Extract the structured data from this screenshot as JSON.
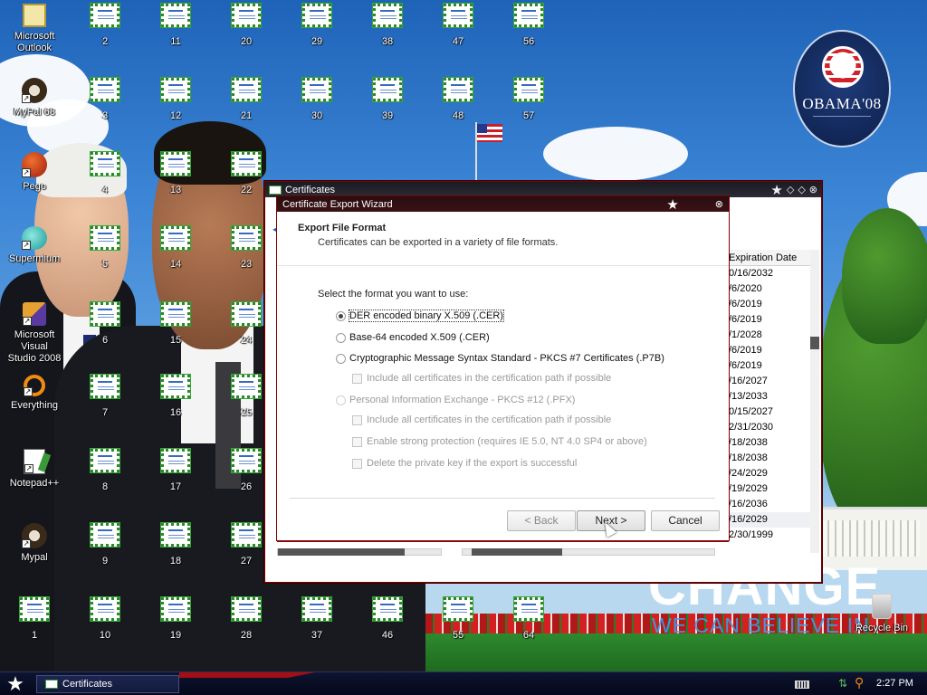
{
  "desktop": {
    "app_icons": [
      {
        "label": "Microsoft\nOutlook",
        "icon": "outlook-icon"
      },
      {
        "label": "MyPal 68",
        "icon": "mypal-icon"
      },
      {
        "label": "Pego",
        "icon": "pego-icon"
      },
      {
        "label": "Supermium",
        "icon": "supermium-icon"
      },
      {
        "label": "Microsoft Visual\nStudio 2008",
        "icon": "visual-studio-icon"
      },
      {
        "label": "Everything",
        "icon": "everything-icon"
      },
      {
        "label": "Notepad++",
        "icon": "notepad-plus-plus-icon"
      },
      {
        "label": "Mypal",
        "icon": "mypal-icon"
      },
      {
        "label": "1",
        "icon": "certificate-icon"
      }
    ],
    "cert_icons": [
      [
        "2",
        "3",
        "4",
        "5",
        "6",
        "7",
        "8",
        "9",
        "10"
      ],
      [
        "11",
        "12",
        "13",
        "14",
        "15",
        "16",
        "17",
        "18",
        "19"
      ],
      [
        "20",
        "21",
        "22",
        "23",
        "24",
        "25",
        "26",
        "27",
        "28"
      ],
      [
        "29",
        "30",
        "",
        "",
        "",
        "",
        "",
        "",
        "37"
      ],
      [
        "38",
        "39",
        "",
        "",
        "",
        "",
        "",
        "",
        "46"
      ],
      [
        "47",
        "48",
        "",
        "",
        "",
        "",
        "",
        "",
        "55"
      ],
      [
        "56",
        "57",
        "",
        "",
        "",
        "",
        "",
        "",
        "64"
      ]
    ],
    "recycle_bin": "Recycle Bin",
    "wallpaper": {
      "logo_text": "OBAMA'08",
      "slogan_main": "CHANGE",
      "slogan_sub": "WE CAN BELIEVE IN"
    }
  },
  "cert_window": {
    "title": "Certificates",
    "column_header": "Expiration Date",
    "expiration_dates": [
      "0/16/2032",
      "/6/2020",
      "/6/2019",
      "/6/2019",
      "/1/2028",
      "/6/2019",
      "/6/2019",
      "/16/2027",
      "/13/2033",
      "0/15/2027",
      "2/31/2030",
      "/18/2038",
      "/18/2038",
      "/24/2029",
      "/19/2029",
      "/16/2036",
      "/16/2029",
      "2/30/1999"
    ]
  },
  "wizard": {
    "title": "Certificate Export Wizard",
    "header_title": "Export File Format",
    "header_subtitle": "Certificates can be exported in a variety of file formats.",
    "prompt": "Select the format you want to use:",
    "options": {
      "der": "DER encoded binary X.509 (.CER)",
      "base64": "Base-64 encoded X.509 (.CER)",
      "pkcs7": "Cryptographic Message Syntax Standard - PKCS #7 Certificates (.P7B)",
      "pkcs7_include_all": "Include all certificates in the certification path if possible",
      "pfx": "Personal Information Exchange - PKCS #12 (.PFX)",
      "pfx_include_all": "Include all certificates in the certification path if possible",
      "pfx_strong_protection": "Enable strong protection (requires IE 5.0, NT 4.0 SP4 or above)",
      "pfx_delete_key": "Delete the private key if the export is successful"
    },
    "selected_option": "der",
    "buttons": {
      "back": "< Back",
      "next": "Next >",
      "cancel": "Cancel"
    }
  },
  "taskbar": {
    "task_label": "Certificates",
    "clock": "2:27 PM"
  },
  "colors": {
    "window_border": "#7a0000",
    "taskbar": "#0e1430",
    "cert_green": "#2a8a2a"
  }
}
